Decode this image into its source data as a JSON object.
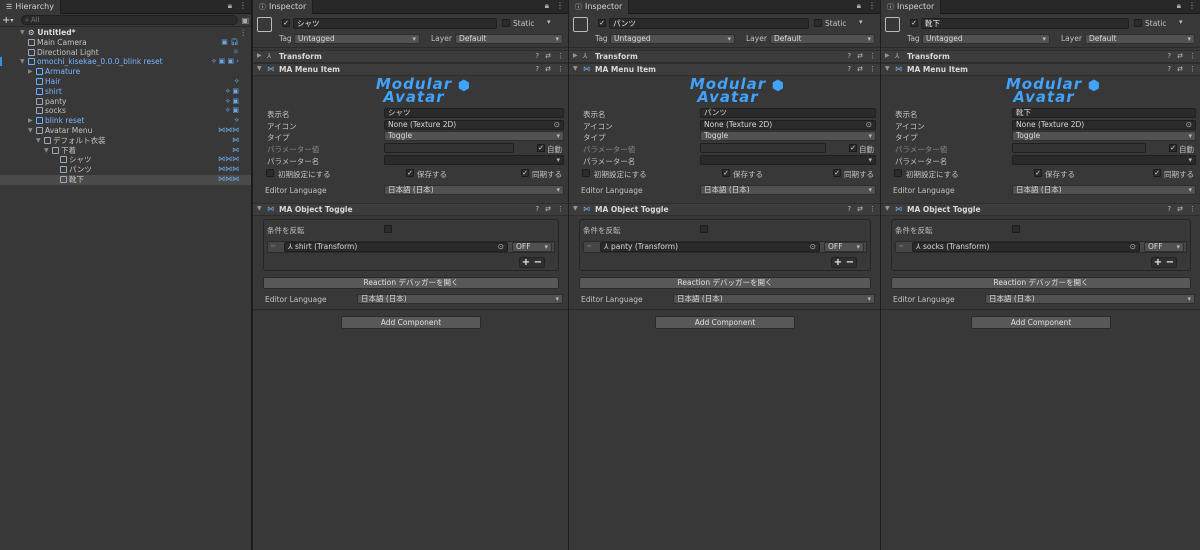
{
  "hierarchy": {
    "tab": "Hierarchy",
    "search_placeholder": "All",
    "scene": "Untitled*",
    "items": [
      {
        "label": "Main Camera",
        "indent": 2,
        "kind": "normal"
      },
      {
        "label": "Directional Light",
        "indent": 2,
        "kind": "normal"
      },
      {
        "label": "omochi_kisekae_0.0.0_blink reset",
        "indent": 2,
        "kind": "blue",
        "arrow": "▼"
      },
      {
        "label": "Armature",
        "indent": 3,
        "kind": "blue",
        "arrow": "▶"
      },
      {
        "label": "Hair",
        "indent": 3,
        "kind": "blue"
      },
      {
        "label": "shirt",
        "indent": 3,
        "kind": "blue"
      },
      {
        "label": "panty",
        "indent": 3,
        "kind": "normal"
      },
      {
        "label": "socks",
        "indent": 3,
        "kind": "normal"
      },
      {
        "label": "blink reset",
        "indent": 3,
        "kind": "blue",
        "arrow": "▶"
      },
      {
        "label": "Avatar Menu",
        "indent": 3,
        "kind": "normal",
        "arrow": "▼"
      },
      {
        "label": "デフォルト衣装",
        "indent": 4,
        "kind": "normal",
        "arrow": "▼"
      },
      {
        "label": "下着",
        "indent": 5,
        "kind": "normal",
        "arrow": "▼"
      },
      {
        "label": "シャツ",
        "indent": 6,
        "kind": "normal"
      },
      {
        "label": "パンツ",
        "indent": 6,
        "kind": "normal"
      },
      {
        "label": "靴下",
        "indent": 6,
        "kind": "normal",
        "selected": true
      }
    ]
  },
  "common": {
    "tab": "Inspector",
    "static": "Static",
    "tag_label": "Tag",
    "tag": "Untagged",
    "layer_label": "Layer",
    "layer": "Default",
    "transform": "Transform",
    "menu_item": "MA Menu Item",
    "logo_line1": "Modular",
    "logo_line2": "Avatar",
    "display_name_label": "表示名",
    "icon_label": "アイコン",
    "icon_value": "None (Texture 2D)",
    "type_label": "タイプ",
    "type_value": "Toggle",
    "param_label": "パラメーター値",
    "auto_label": "自動",
    "param_name_label": "パラメーター名",
    "initial_label": "初期設定にする",
    "save_label": "保存する",
    "sync_label": "同期する",
    "editor_lang_label": "Editor Language",
    "editor_lang": "日本語 (日本)",
    "object_toggle": "MA Object Toggle",
    "invert_label": "条件を反転",
    "off": "OFF",
    "plus": "+",
    "minus": "−",
    "reaction_btn": "Reaction デバッガーを開く",
    "add_component": "Add Component"
  },
  "inspectors": [
    {
      "name": "シャツ",
      "target": "shirt (Transform)"
    },
    {
      "name": "パンツ",
      "target": "panty (Transform)"
    },
    {
      "name": "靴下",
      "target": "socks (Transform)"
    }
  ]
}
